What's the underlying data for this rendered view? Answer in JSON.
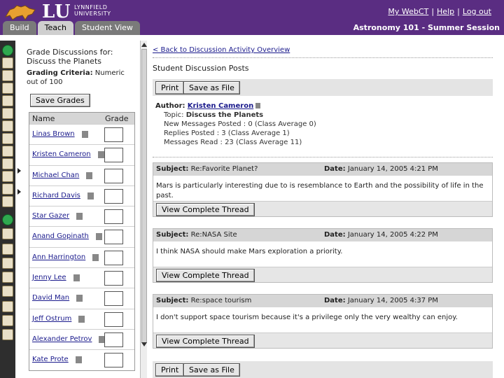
{
  "header": {
    "logo_text": "LU",
    "logo_sub_1": "LYNNFIELD",
    "logo_sub_2": "UNIVERSITY",
    "links": [
      "My WebCT",
      "Help",
      "Log out"
    ],
    "tabs": [
      {
        "label": "Build",
        "active": false
      },
      {
        "label": "Teach",
        "active": true
      },
      {
        "label": "Student View",
        "active": false
      }
    ],
    "course_title": "Astronomy 101 - Summer Session",
    "color": "#5a2d82"
  },
  "grade_panel": {
    "title_1": "Grade Discussions for:",
    "title_2": "Discuss the Planets",
    "criteria_label": "Grading Criteria:",
    "criteria_value": "Numeric out of 100",
    "save_label": "Save Grades",
    "col_name": "Name",
    "col_grade": "Grade",
    "students": [
      {
        "name": "Linas Brown",
        "grade": ""
      },
      {
        "name": "Kristen Cameron",
        "grade": ""
      },
      {
        "name": "Michael Chan",
        "grade": ""
      },
      {
        "name": "Richard Davis",
        "grade": ""
      },
      {
        "name": "Star Gazer",
        "grade": ""
      },
      {
        "name": "Anand Gopinath",
        "grade": ""
      },
      {
        "name": "Ann Harrington",
        "grade": ""
      },
      {
        "name": "Jenny Lee",
        "grade": ""
      },
      {
        "name": "David Man",
        "grade": ""
      },
      {
        "name": "Jeff Ostrum",
        "grade": ""
      },
      {
        "name": "Alexander Petrov",
        "grade": ""
      },
      {
        "name": "Kate Prote",
        "grade": ""
      }
    ]
  },
  "main": {
    "back_link": "< Back to Discussion Activity Overview",
    "page_title": "Student Discussion Posts",
    "print_label": "Print",
    "save_file_label": "Save as File",
    "author_label": "Author:",
    "author_name": "Kristen Cameron",
    "topic_label": "Topic:",
    "topic_value": "Discuss the Planets",
    "new_messages": "New Messages Posted : 0 (Class Average 0)",
    "replies": "Replies Posted : 3 (Class Average 1)",
    "read": "Messages Read : 23 (Class Average 11)",
    "subject_label": "Subject:",
    "date_label": "Date:",
    "view_thread_label": "View Complete Thread",
    "posts": [
      {
        "subject": "Re:Favorite Planet?",
        "date": "January 14, 2005 4:21 PM",
        "body": "Mars is particularly interesting due to is resemblance to Earth and the possibility of life in the past."
      },
      {
        "subject": "Re:NASA Site",
        "date": "January 14, 2005 4:22 PM",
        "body": "I think NASA should make Mars exploration a priority."
      },
      {
        "subject": "Re:space tourism",
        "date": "January 14, 2005 4:37 PM",
        "body": "I don't support space tourism because it's a privilege only the very wealthy can enjoy."
      }
    ]
  }
}
